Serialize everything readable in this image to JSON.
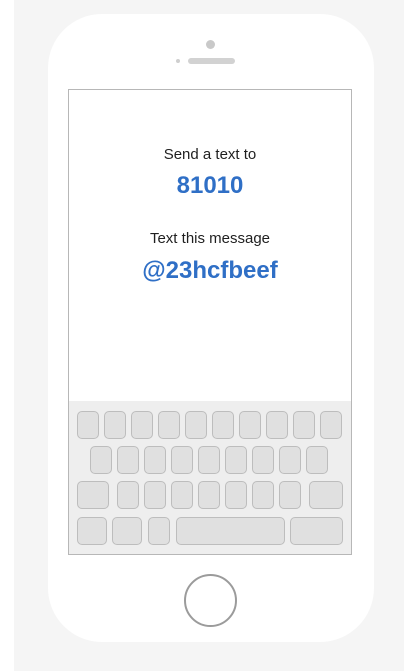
{
  "message": {
    "send_label": "Send a text to",
    "number": "81010",
    "text_label": "Text this message",
    "code": "@23hcfbeef"
  },
  "colors": {
    "accent": "#2f6fc6",
    "text": "#1f1f1f",
    "key_fill": "#e0e0e0",
    "key_border": "#bdbdbd",
    "phone_outline": "#b7b7b7"
  },
  "icons": {
    "camera": "camera-icon",
    "speaker": "speaker-icon",
    "home": "home-button-icon"
  }
}
